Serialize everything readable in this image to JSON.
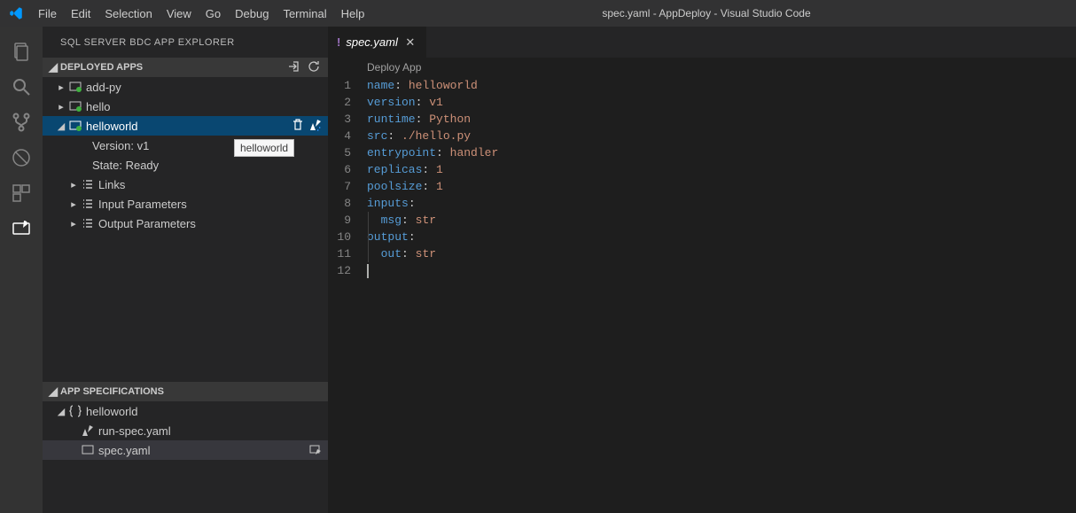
{
  "window": {
    "title": "spec.yaml - AppDeploy - Visual Studio Code"
  },
  "menu": {
    "items": [
      "File",
      "Edit",
      "Selection",
      "View",
      "Go",
      "Debug",
      "Terminal",
      "Help"
    ]
  },
  "sidebar": {
    "title": "SQL SERVER BDC APP EXPLORER",
    "sections": {
      "deployed": {
        "label": "DEPLOYED APPS",
        "items": [
          {
            "label": "add-py"
          },
          {
            "label": "hello"
          },
          {
            "label": "helloworld",
            "selected": true,
            "tooltip": "helloworld",
            "children": [
              {
                "label": "Version: v1"
              },
              {
                "label": "State: Ready"
              },
              {
                "label": "Links",
                "expandable": true
              },
              {
                "label": "Input Parameters",
                "expandable": true
              },
              {
                "label": "Output Parameters",
                "expandable": true
              }
            ]
          }
        ]
      },
      "specs": {
        "label": "APP SPECIFICATIONS",
        "items": [
          {
            "label": "helloworld",
            "children": [
              {
                "label": "run-spec.yaml"
              },
              {
                "label": "spec.yaml",
                "selected": true
              }
            ]
          }
        ]
      }
    }
  },
  "tab": {
    "label": "spec.yaml"
  },
  "breadcrumb": {
    "label": "Deploy App"
  },
  "code": {
    "lines": [
      {
        "n": 1,
        "key": "name",
        "val": "helloworld"
      },
      {
        "n": 2,
        "key": "version",
        "val": "v1"
      },
      {
        "n": 3,
        "key": "runtime",
        "val": "Python"
      },
      {
        "n": 4,
        "key": "src",
        "val": "./hello.py"
      },
      {
        "n": 5,
        "key": "entrypoint",
        "val": "handler"
      },
      {
        "n": 6,
        "key": "replicas",
        "val": "1"
      },
      {
        "n": 7,
        "key": "poolsize",
        "val": "1"
      },
      {
        "n": 8,
        "key": "inputs",
        "val": ""
      },
      {
        "n": 9,
        "indent": 1,
        "key": "msg",
        "val": "str"
      },
      {
        "n": 10,
        "key": "output",
        "val": ""
      },
      {
        "n": 11,
        "indent": 1,
        "key": "out",
        "val": "str"
      },
      {
        "n": 12
      }
    ]
  }
}
